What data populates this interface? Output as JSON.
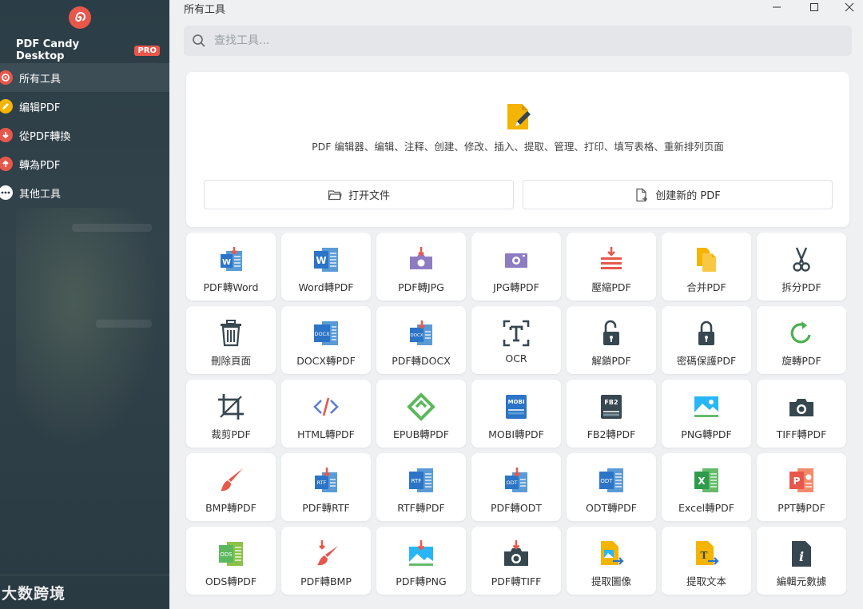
{
  "app": {
    "name": "PDF Candy Desktop",
    "badge": "PRO",
    "window_title": "所有工具"
  },
  "sidebar": {
    "items": [
      {
        "label": "所有工具",
        "icon": "candy-icon",
        "color": "#e8574b"
      },
      {
        "label": "编辑PDF",
        "icon": "edit-icon",
        "color": "#f4b400"
      },
      {
        "label": "從PDF轉換",
        "icon": "arrow-down-icon",
        "color": "#e8574b"
      },
      {
        "label": "轉為PDF",
        "icon": "arrow-up-icon",
        "color": "#e8574b"
      },
      {
        "label": "其他工具",
        "icon": "more-icon",
        "color": "#ffffff"
      }
    ],
    "watermark": "大数跨境"
  },
  "search": {
    "placeholder": "查找工具..."
  },
  "hero": {
    "description": "PDF 编辑器、编辑、注释、创建、修改、插入、提取、管理、打印、填写表格、重新排列页面",
    "open_file_label": "打开文件",
    "create_pdf_label": "创建新的 PDF"
  },
  "tools": [
    {
      "label": "PDF轉Word",
      "icon": "pdf-to-word-icon"
    },
    {
      "label": "Word轉PDF",
      "icon": "word-to-pdf-icon"
    },
    {
      "label": "PDF轉JPG",
      "icon": "pdf-to-jpg-icon"
    },
    {
      "label": "JPG轉PDF",
      "icon": "jpg-to-pdf-icon"
    },
    {
      "label": "壓縮PDF",
      "icon": "compress-icon"
    },
    {
      "label": "合并PDF",
      "icon": "merge-icon"
    },
    {
      "label": "拆分PDF",
      "icon": "scissors-icon"
    },
    {
      "label": "刪除頁面",
      "icon": "trash-icon"
    },
    {
      "label": "DOCX轉PDF",
      "icon": "docx-to-pdf-icon"
    },
    {
      "label": "PDF轉DOCX",
      "icon": "pdf-to-docx-icon"
    },
    {
      "label": "OCR",
      "icon": "ocr-icon"
    },
    {
      "label": "解鎖PDF",
      "icon": "unlock-icon"
    },
    {
      "label": "密碼保護PDF",
      "icon": "lock-icon"
    },
    {
      "label": "旋轉PDF",
      "icon": "rotate-icon"
    },
    {
      "label": "裁剪PDF",
      "icon": "crop-icon"
    },
    {
      "label": "HTML轉PDF",
      "icon": "html-icon"
    },
    {
      "label": "EPUB轉PDF",
      "icon": "epub-icon"
    },
    {
      "label": "MOBI轉PDF",
      "icon": "mobi-icon"
    },
    {
      "label": "FB2轉PDF",
      "icon": "fb2-icon"
    },
    {
      "label": "PNG轉PDF",
      "icon": "png-icon"
    },
    {
      "label": "TIFF轉PDF",
      "icon": "camera-icon"
    },
    {
      "label": "BMP轉PDF",
      "icon": "brush-icon"
    },
    {
      "label": "PDF轉RTF",
      "icon": "pdf-to-rtf-icon"
    },
    {
      "label": "RTF轉PDF",
      "icon": "rtf-to-pdf-icon"
    },
    {
      "label": "PDF轉ODT",
      "icon": "pdf-to-odt-icon"
    },
    {
      "label": "ODT轉PDF",
      "icon": "odt-to-pdf-icon"
    },
    {
      "label": "Excel轉PDF",
      "icon": "excel-icon"
    },
    {
      "label": "PPT轉PDF",
      "icon": "ppt-icon"
    },
    {
      "label": "ODS轉PDF",
      "icon": "ods-icon"
    },
    {
      "label": "PDF轉BMP",
      "icon": "pdf-to-bmp-icon"
    },
    {
      "label": "PDF轉PNG",
      "icon": "pdf-to-png-icon"
    },
    {
      "label": "PDF轉TIFF",
      "icon": "pdf-to-tiff-icon"
    },
    {
      "label": "提取圖像",
      "icon": "extract-image-icon"
    },
    {
      "label": "提取文本",
      "icon": "extract-text-icon"
    },
    {
      "label": "編輯元數據",
      "icon": "metadata-icon"
    }
  ]
}
